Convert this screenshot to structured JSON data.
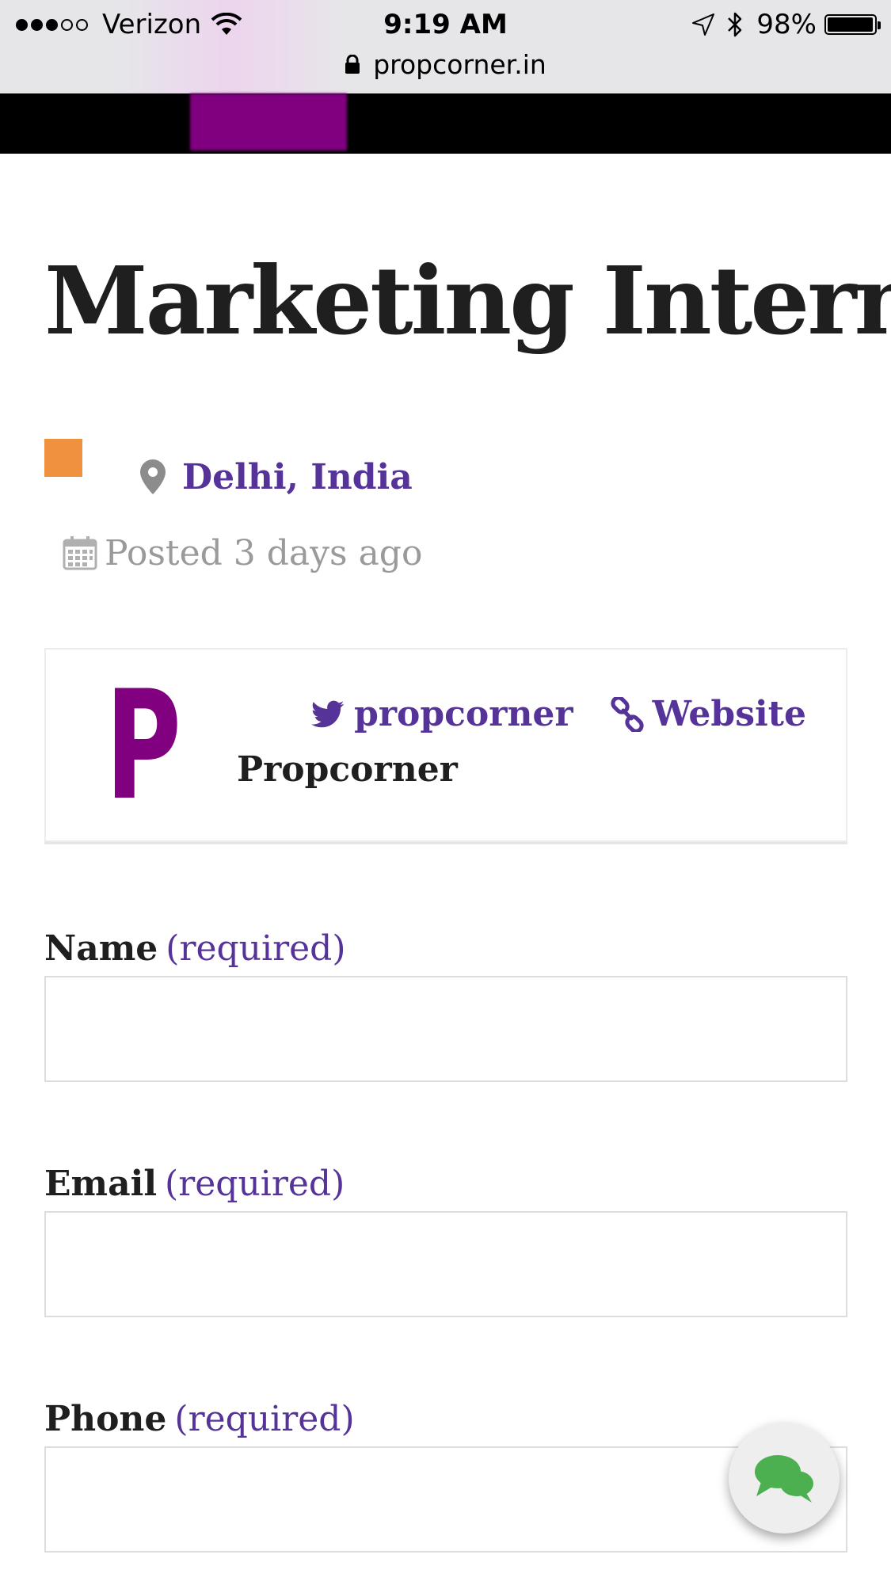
{
  "status_bar": {
    "carrier": "Verizon",
    "time": "9:19 AM",
    "battery_percent": "98%",
    "battery_level": 0.98,
    "signal_bars_filled": 3,
    "signal_bars_total": 5,
    "icons": [
      "signal-dots-icon",
      "wifi-icon",
      "location-arrow-icon",
      "bluetooth-icon",
      "battery-icon"
    ]
  },
  "browser": {
    "url": "propcorner.in",
    "lock_icon": "lock-icon"
  },
  "site_header": {
    "background_color": "#000000",
    "brand_color": "#800080"
  },
  "job": {
    "title": "Marketing Intern",
    "type_color": "#f0913f",
    "location": "Delhi, India",
    "location_icon": "map-pin-icon",
    "posted": "Posted 3 days ago",
    "posted_icon": "calendar-icon"
  },
  "company": {
    "logo_letter": "P",
    "logo_color": "#800080",
    "name": "Propcorner",
    "twitter_handle": "propcorner",
    "twitter_icon": "twitter-icon",
    "website_label": "Website",
    "website_icon": "link-icon"
  },
  "form": {
    "fields": [
      {
        "label": "Name",
        "required_note": "(required)",
        "value": ""
      },
      {
        "label": "Email",
        "required_note": "(required)",
        "value": ""
      },
      {
        "label": "Phone",
        "required_note": "(required)",
        "value": ""
      }
    ]
  },
  "chat_button": {
    "icon": "chat-bubbles-icon",
    "color": "#4caf50"
  },
  "colors": {
    "link": "#553399",
    "text": "#1f1f1f",
    "muted": "#9a9a9a"
  }
}
